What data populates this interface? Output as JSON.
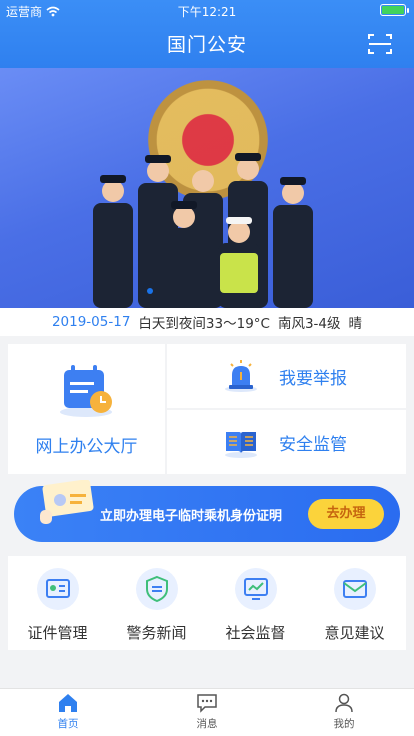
{
  "status_bar": {
    "carrier": "运营商",
    "time": "下午12:21"
  },
  "header": {
    "title": "国门公安"
  },
  "weather": {
    "date": "2019-05-17",
    "forecast": "白天到夜间33～19°C",
    "wind": "南风3-4级",
    "condition": "晴"
  },
  "quick": {
    "hall": "网上办公大厅",
    "report": "我要举报",
    "safety": "安全监管"
  },
  "promo": {
    "text": "立即办理电子临时乘机身份证明",
    "button": "去办理"
  },
  "services": [
    {
      "label": "证件管理",
      "icon": "id-card-icon"
    },
    {
      "label": "警务新闻",
      "icon": "shield-news-icon"
    },
    {
      "label": "社会监督",
      "icon": "monitor-icon"
    },
    {
      "label": "意见建议",
      "icon": "mail-icon"
    }
  ],
  "tabbar": {
    "home": "首页",
    "messages": "消息",
    "mine": "我的"
  },
  "colors": {
    "primary": "#2f80ef",
    "promo_button": "#fbd33b",
    "battery": "#42d35c"
  }
}
